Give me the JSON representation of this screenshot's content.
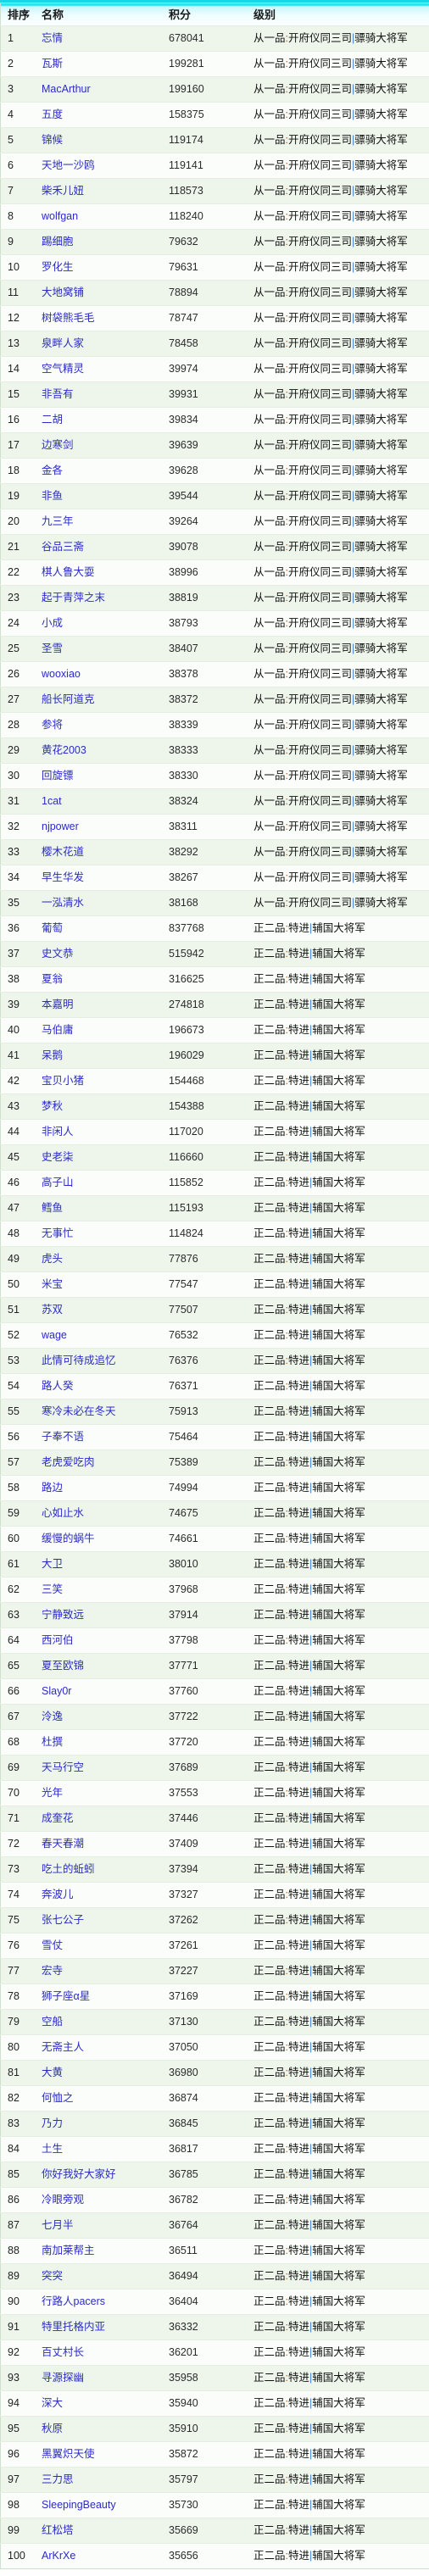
{
  "table": {
    "columns": [
      {
        "key": "rank",
        "label": "排序"
      },
      {
        "key": "name",
        "label": "名称"
      },
      {
        "key": "score",
        "label": "积分"
      },
      {
        "key": "level",
        "label": "级别"
      }
    ],
    "level_variants": {
      "a": {
        "grade": "从一品",
        "sep1": ":",
        "office": "开府仪同三司",
        "sep2": "|",
        "title": "骠骑大将军"
      },
      "b": {
        "grade": "正二品",
        "sep1": ":",
        "office": "特进",
        "sep2": "|",
        "title": "辅国大将军"
      }
    },
    "rows": [
      {
        "rank": "1",
        "name": "忘情",
        "score": "678041",
        "lv": "a"
      },
      {
        "rank": "2",
        "name": "瓦斯",
        "score": "199281",
        "lv": "a"
      },
      {
        "rank": "3",
        "name": "MacArthur",
        "score": "199160",
        "lv": "a"
      },
      {
        "rank": "4",
        "name": "五度",
        "score": "158375",
        "lv": "a"
      },
      {
        "rank": "5",
        "name": "锦候",
        "score": "119174",
        "lv": "a"
      },
      {
        "rank": "6",
        "name": "天地一沙鸥",
        "score": "119141",
        "lv": "a"
      },
      {
        "rank": "7",
        "name": "柴禾儿妞",
        "score": "118573",
        "lv": "a"
      },
      {
        "rank": "8",
        "name": "wolfgan",
        "score": "118240",
        "lv": "a"
      },
      {
        "rank": "9",
        "name": "踢细胞",
        "score": "79632",
        "lv": "a"
      },
      {
        "rank": "10",
        "name": "罗化生",
        "score": "79631",
        "lv": "a"
      },
      {
        "rank": "11",
        "name": "大地窝铺",
        "score": "78894",
        "lv": "a"
      },
      {
        "rank": "12",
        "name": "树袋熊毛毛",
        "score": "78747",
        "lv": "a"
      },
      {
        "rank": "13",
        "name": "泉畔人家",
        "score": "78458",
        "lv": "a"
      },
      {
        "rank": "14",
        "name": "空气精灵",
        "score": "39974",
        "lv": "a"
      },
      {
        "rank": "15",
        "name": "非吾有",
        "score": "39931",
        "lv": "a"
      },
      {
        "rank": "16",
        "name": "二胡",
        "score": "39834",
        "lv": "a"
      },
      {
        "rank": "17",
        "name": "边寒剑",
        "score": "39639",
        "lv": "a"
      },
      {
        "rank": "18",
        "name": "金各",
        "score": "39628",
        "lv": "a"
      },
      {
        "rank": "19",
        "name": "非鱼",
        "score": "39544",
        "lv": "a"
      },
      {
        "rank": "20",
        "name": "九三年",
        "score": "39264",
        "lv": "a"
      },
      {
        "rank": "21",
        "name": "谷品三斋",
        "score": "39078",
        "lv": "a"
      },
      {
        "rank": "22",
        "name": "棋人鲁大耍",
        "score": "38996",
        "lv": "a"
      },
      {
        "rank": "23",
        "name": "起于青萍之末",
        "score": "38819",
        "lv": "a"
      },
      {
        "rank": "24",
        "name": "小成",
        "score": "38793",
        "lv": "a"
      },
      {
        "rank": "25",
        "name": "圣雪",
        "score": "38407",
        "lv": "a"
      },
      {
        "rank": "26",
        "name": "wooxiao",
        "score": "38378",
        "lv": "a"
      },
      {
        "rank": "27",
        "name": "船长阿道克",
        "score": "38372",
        "lv": "a"
      },
      {
        "rank": "28",
        "name": "参将",
        "score": "38339",
        "lv": "a"
      },
      {
        "rank": "29",
        "name": "黄花2003",
        "score": "38333",
        "lv": "a"
      },
      {
        "rank": "30",
        "name": "回旋镖",
        "score": "38330",
        "lv": "a"
      },
      {
        "rank": "31",
        "name": "1cat",
        "score": "38324",
        "lv": "a"
      },
      {
        "rank": "32",
        "name": "njpower",
        "score": "38311",
        "lv": "a"
      },
      {
        "rank": "33",
        "name": "樱木花道",
        "score": "38292",
        "lv": "a"
      },
      {
        "rank": "34",
        "name": "早生华发",
        "score": "38267",
        "lv": "a"
      },
      {
        "rank": "35",
        "name": "一泓清水",
        "score": "38168",
        "lv": "a"
      },
      {
        "rank": "36",
        "name": "葡萄",
        "score": "837768",
        "lv": "b"
      },
      {
        "rank": "37",
        "name": "史文恭",
        "score": "515942",
        "lv": "b"
      },
      {
        "rank": "38",
        "name": "夏翁",
        "score": "316625",
        "lv": "b"
      },
      {
        "rank": "39",
        "name": "本嘉明",
        "score": "274818",
        "lv": "b"
      },
      {
        "rank": "40",
        "name": "马伯庸",
        "score": "196673",
        "lv": "b"
      },
      {
        "rank": "41",
        "name": "呆鹅",
        "score": "196029",
        "lv": "b"
      },
      {
        "rank": "42",
        "name": "宝贝小猪",
        "score": "154468",
        "lv": "b"
      },
      {
        "rank": "43",
        "name": "梦秋",
        "score": "154388",
        "lv": "b"
      },
      {
        "rank": "44",
        "name": "非闲人",
        "score": "117020",
        "lv": "b"
      },
      {
        "rank": "45",
        "name": "史老柒",
        "score": "116660",
        "lv": "b"
      },
      {
        "rank": "46",
        "name": "高子山",
        "score": "115852",
        "lv": "b"
      },
      {
        "rank": "47",
        "name": "鳕鱼",
        "score": "115193",
        "lv": "b"
      },
      {
        "rank": "48",
        "name": "无事忙",
        "score": "114824",
        "lv": "b"
      },
      {
        "rank": "49",
        "name": "虎头",
        "score": "77876",
        "lv": "b"
      },
      {
        "rank": "50",
        "name": "米宝",
        "score": "77547",
        "lv": "b"
      },
      {
        "rank": "51",
        "name": "苏双",
        "score": "77507",
        "lv": "b"
      },
      {
        "rank": "52",
        "name": "wage",
        "score": "76532",
        "lv": "b"
      },
      {
        "rank": "53",
        "name": "此情可待成追忆",
        "score": "76376",
        "lv": "b"
      },
      {
        "rank": "54",
        "name": "路人癸",
        "score": "76371",
        "lv": "b"
      },
      {
        "rank": "55",
        "name": "寒冷未必在冬天",
        "score": "75913",
        "lv": "b"
      },
      {
        "rank": "56",
        "name": "子奉不语",
        "score": "75464",
        "lv": "b"
      },
      {
        "rank": "57",
        "name": "老虎爱吃肉",
        "score": "75389",
        "lv": "b"
      },
      {
        "rank": "58",
        "name": "路边",
        "score": "74994",
        "lv": "b"
      },
      {
        "rank": "59",
        "name": "心如止水",
        "score": "74675",
        "lv": "b"
      },
      {
        "rank": "60",
        "name": "缓慢的蜗牛",
        "score": "74661",
        "lv": "b"
      },
      {
        "rank": "61",
        "name": "大卫",
        "score": "38010",
        "lv": "b"
      },
      {
        "rank": "62",
        "name": "三笑",
        "score": "37968",
        "lv": "b"
      },
      {
        "rank": "63",
        "name": "宁静致远",
        "score": "37914",
        "lv": "b"
      },
      {
        "rank": "64",
        "name": "西河伯",
        "score": "37798",
        "lv": "b"
      },
      {
        "rank": "65",
        "name": "夏至欧锦",
        "score": "37771",
        "lv": "b"
      },
      {
        "rank": "66",
        "name": "Slay0r",
        "score": "37760",
        "lv": "b"
      },
      {
        "rank": "67",
        "name": "泠逸",
        "score": "37722",
        "lv": "b"
      },
      {
        "rank": "68",
        "name": "杜撰",
        "score": "37720",
        "lv": "b"
      },
      {
        "rank": "69",
        "name": "天马行空",
        "score": "37689",
        "lv": "b"
      },
      {
        "rank": "70",
        "name": "光年",
        "score": "37553",
        "lv": "b"
      },
      {
        "rank": "71",
        "name": "成奎花",
        "score": "37446",
        "lv": "b"
      },
      {
        "rank": "72",
        "name": "春天春潮",
        "score": "37409",
        "lv": "b"
      },
      {
        "rank": "73",
        "name": "吃土的蚯蚓",
        "score": "37394",
        "lv": "b"
      },
      {
        "rank": "74",
        "name": "奔波儿",
        "score": "37327",
        "lv": "b"
      },
      {
        "rank": "75",
        "name": "张七公子",
        "score": "37262",
        "lv": "b"
      },
      {
        "rank": "76",
        "name": "雪仗",
        "score": "37261",
        "lv": "b"
      },
      {
        "rank": "77",
        "name": "宏寺",
        "score": "37227",
        "lv": "b"
      },
      {
        "rank": "78",
        "name": "狮子座α星",
        "score": "37169",
        "lv": "b"
      },
      {
        "rank": "79",
        "name": "空船",
        "score": "37130",
        "lv": "b"
      },
      {
        "rank": "80",
        "name": "无斋主人",
        "score": "37050",
        "lv": "b"
      },
      {
        "rank": "81",
        "name": "大黄",
        "score": "36980",
        "lv": "b"
      },
      {
        "rank": "82",
        "name": "何恤之",
        "score": "36874",
        "lv": "b"
      },
      {
        "rank": "83",
        "name": "乃力",
        "score": "36845",
        "lv": "b"
      },
      {
        "rank": "84",
        "name": "土生",
        "score": "36817",
        "lv": "b"
      },
      {
        "rank": "85",
        "name": "你好我好大家好",
        "score": "36785",
        "lv": "b"
      },
      {
        "rank": "86",
        "name": "冷眼旁观",
        "score": "36782",
        "lv": "b"
      },
      {
        "rank": "87",
        "name": "七月半",
        "score": "36764",
        "lv": "b"
      },
      {
        "rank": "88",
        "name": "南加莱帮主",
        "score": "36511",
        "lv": "b"
      },
      {
        "rank": "89",
        "name": "突突",
        "score": "36494",
        "lv": "b"
      },
      {
        "rank": "90",
        "name": "行路人pacers",
        "score": "36404",
        "lv": "b"
      },
      {
        "rank": "91",
        "name": "特里托格内亚",
        "score": "36332",
        "lv": "b"
      },
      {
        "rank": "92",
        "name": "百丈村长",
        "score": "36201",
        "lv": "b"
      },
      {
        "rank": "93",
        "name": "寻源探幽",
        "score": "35958",
        "lv": "b"
      },
      {
        "rank": "94",
        "name": "深大",
        "score": "35940",
        "lv": "b"
      },
      {
        "rank": "95",
        "name": "秋原",
        "score": "35910",
        "lv": "b"
      },
      {
        "rank": "96",
        "name": "黑翼炽天使",
        "score": "35872",
        "lv": "b"
      },
      {
        "rank": "97",
        "name": "三力思",
        "score": "35797",
        "lv": "b"
      },
      {
        "rank": "98",
        "name": "SleepingBeauty",
        "score": "35730",
        "lv": "b"
      },
      {
        "rank": "99",
        "name": "红松塔",
        "score": "35669",
        "lv": "b"
      },
      {
        "rank": "100",
        "name": "ArKrXe",
        "score": "35656",
        "lv": "b"
      }
    ]
  },
  "colors": {
    "header_accent": "#16d7e6",
    "row_odd": "#eef6ec",
    "row_even": "#fbfdfa",
    "name_link": "#2b2bc8",
    "sep_office": "#b35a12",
    "sep_title": "#3d7fd6"
  }
}
